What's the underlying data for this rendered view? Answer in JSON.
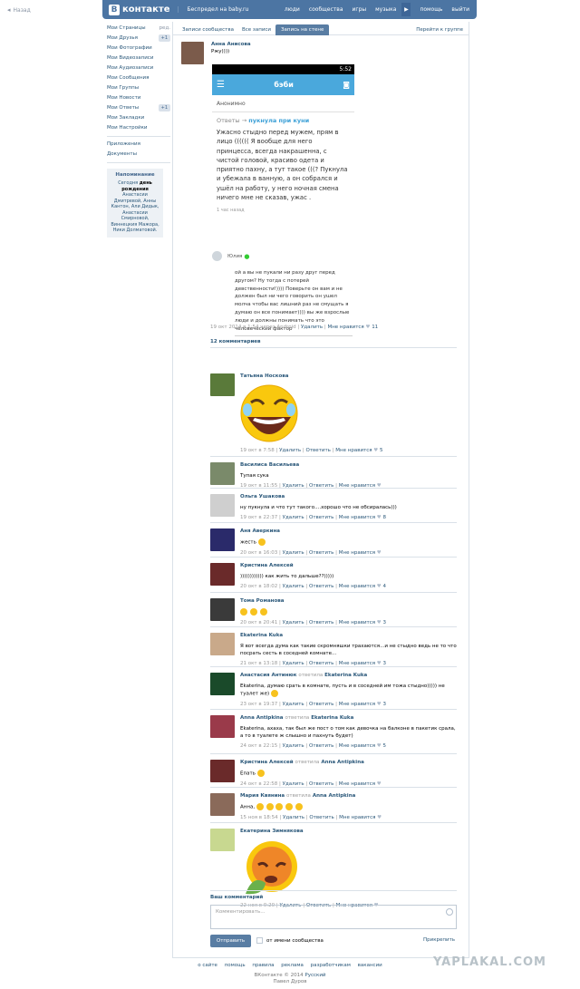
{
  "back_label": "Назад",
  "topbar": {
    "logo": "контакте",
    "logo_letter": "В",
    "public": "Беспредел на baby.ru",
    "menu": [
      "люди",
      "сообщества",
      "игры",
      "музыка",
      "помощь",
      "выйти"
    ]
  },
  "sidebar": {
    "items": [
      {
        "label": "Мои Страницы",
        "extra": "ред."
      },
      {
        "label": "Мои Друзья",
        "badge": "+1"
      },
      {
        "label": "Мои Фотографии"
      },
      {
        "label": "Мои Видеозаписи"
      },
      {
        "label": "Мои Аудиозаписи"
      },
      {
        "label": "Мои Сообщения"
      },
      {
        "label": "Мои Группы"
      },
      {
        "label": "Мои Новости"
      },
      {
        "label": "Мои Ответы",
        "badge": "+1"
      },
      {
        "label": "Мои Закладки"
      },
      {
        "label": "Мои Настройки"
      }
    ],
    "apps": "Приложения",
    "docs": "Документы",
    "reminder_title": "Напоминание",
    "reminder_pre": "Сегодня ",
    "reminder_bold": "день рождения",
    "reminder_post": " Анастасии Дмитревой, Анны Кантон, Али Дидык, Анастасии Смирновой, Виннецкия Мажора, Ники Долматовой."
  },
  "tabs": {
    "items": [
      "Записи сообщества",
      "Все записи",
      "Запись на стене"
    ],
    "active_index": 2,
    "right": "Перейти к группе"
  },
  "post": {
    "author": "Анна Анисова",
    "text": "Ржу))))",
    "screenshot": {
      "time": "5:52",
      "brand": "бэби",
      "anon": "Анонимно",
      "replies_prefix": "Ответы → ",
      "replies_topic": "пукнула при куни",
      "body": "Ужасно стыдно перед мужем, прям в лицо (((((( Я вообще для него принцесса, всегда накрашенна, с чистой головой, красиво одета и приятно пахну, а тут такое (((? Пукнула и убежала в ванную, а он собрался и ушёл на работу, у него ночная смена ничего мне не сказав, ужас .",
      "ago": "1 час назад"
    },
    "screenshot2": {
      "user": "Юлия",
      "body": "ой а вы не пукали ни разу друг перед другом? Ну тогда с потерей девственности!)))) Поверьте он вам и не должен был ни чего говорить он ушел молча чтобы вас лишний раз не смущать я думаю он все понимает)))) вы же взрослые люди и должны понимать что это человеческий фактор"
    },
    "meta_date": "19 окт 2014 в 1:54 через Android",
    "meta_delete": "Удалить",
    "meta_like": "Мне нравится",
    "meta_like_count": "11"
  },
  "comments_count": "12 комментариев",
  "comments": [
    {
      "name": "Татьяна Носкова",
      "text": "",
      "meta": "19 окт в 7:58",
      "likes": "5",
      "avatar_color": "#5a7a3a",
      "big": "laugh"
    },
    {
      "name": "Василиса Васильева",
      "text": "Тупая сука",
      "meta": "19 окт в 11:55",
      "likes": "",
      "avatar_color": "#7a8a6a"
    },
    {
      "name": "Ольга Ушакова",
      "text": "ну пукнула и что тут такого....хорошо что не обсиралась)))",
      "meta": "19 окт в 22:37",
      "likes": "8",
      "avatar_color": "#cfcfcf"
    },
    {
      "name": "Аня Аверкина",
      "text": "жесть",
      "meta": "20 окт в 16:03",
      "likes": "",
      "avatar_color": "#2a2a6a",
      "smileys": 1
    },
    {
      "name": "Кристина Алексей",
      "text": ")))))))))))) как жить то дальше??)))))",
      "meta": "20 окт в 18:02",
      "likes": "4",
      "avatar_color": "#6a2a2a"
    },
    {
      "name": "Тома Романова",
      "text": "",
      "meta": "20 окт в 20:41",
      "likes": "3",
      "avatar_color": "#3a3a3a",
      "smileys": 3
    },
    {
      "name": "Ekaterina Kuka",
      "text": "Я вот всегда дума как такие скромняшки трахаются...и не стыдно ведь не то что посрать сесть в соседней комнате...",
      "meta": "21 окт в 13:18",
      "likes": "3",
      "avatar_color": "#c9a98a"
    },
    {
      "name": "Анастасия Антинюк",
      "reply_to": "Ekaterina Kuka",
      "text": "Ekaterina, думаю срать в комнате, пусть и в соседней им тожа стыдно))))) не туалет же)",
      "meta": "23 окт в 19:37",
      "likes": "3",
      "avatar_color": "#1a4a2a",
      "smileys": 1
    },
    {
      "name": "Anna Antipkina",
      "reply_to": "Ekaterina Kuka",
      "text": "Ekaterina, ахаха, так был же пост о том как девочка на балконе в пакетик срала, а то в туалете ж слышно и пахнуть будет)",
      "meta": "24 окт в 22:15",
      "likes": "5",
      "avatar_color": "#9a3a4a"
    },
    {
      "name": "Кристина Алексей",
      "reply_to": "Anna Antipkina",
      "text": "Епать",
      "meta": "24 окт в 22:58",
      "likes": "",
      "avatar_color": "#6a2a2a",
      "smileys": 1
    },
    {
      "name": "Мария Квянина",
      "reply_to": "Anna Antipkina",
      "text": "Анна,",
      "meta": "15 ноя в 18:54",
      "likes": "",
      "avatar_color": "#8a6a5a",
      "smileys": 5
    },
    {
      "name": "Екатерина Зимнякова",
      "text": "",
      "meta": "22 ноя в 0:20",
      "likes": "",
      "avatar_color": "#c8d890",
      "big": "sad"
    }
  ],
  "reply_word": "ответила",
  "actions": {
    "delete": "Удалить",
    "reply": "Ответить",
    "like": "Мне нравится"
  },
  "your_comment": "Ваш комментарий",
  "comment_placeholder": "Комментировать...",
  "send_label": "Отправить",
  "as_community": "от имени сообщества",
  "attach": "Прикрепить",
  "footer": {
    "links": [
      "о сайте",
      "помощь",
      "правила",
      "реклама",
      "разработчикам",
      "вакансии"
    ],
    "copyright": "ВКонтакте © 2014",
    "lang": "Русский",
    "author": "Павел Дуров"
  },
  "watermark": "YAPLAKAL.COM"
}
